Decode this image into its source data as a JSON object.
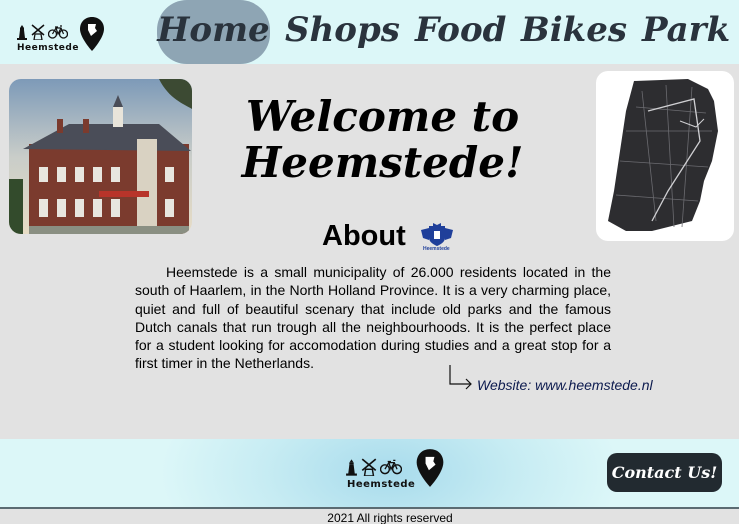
{
  "brand": {
    "logo_text": "Heemstede"
  },
  "nav": [
    {
      "label": "Home",
      "active": true
    },
    {
      "label": "Shops",
      "active": false
    },
    {
      "label": "Food",
      "active": false
    },
    {
      "label": "Bikes",
      "active": false
    },
    {
      "label": "Park",
      "active": false
    }
  ],
  "hero": {
    "title_line1": "Welcome to",
    "title_line2": "Heemstede!"
  },
  "about": {
    "heading": "About",
    "crest_caption": "Heemstede",
    "text": "Heemstede is a small municipality of 26.000 residents located in the south of Haarlem, in the North Holland Province. It is a very charming place, quiet and full of beautiful scenary that include old parks and the famous Dutch canals that run trough all the neighbourhoods. It is the perfect place for a student looking for accomodation during studies and a great stop for a first timer in the Netherlands.",
    "website_label": "Website: www.heemstede.nl"
  },
  "footer": {
    "logo_text": "Heemstede",
    "contact_label": "Contact Us!",
    "copyright": "2021 All rights reserved"
  },
  "colors": {
    "header_bg": "#dcf7f8",
    "nav_active": "#8ea5b4",
    "page_bg": "#e2e2e2",
    "contact_bg": "#222a30"
  }
}
